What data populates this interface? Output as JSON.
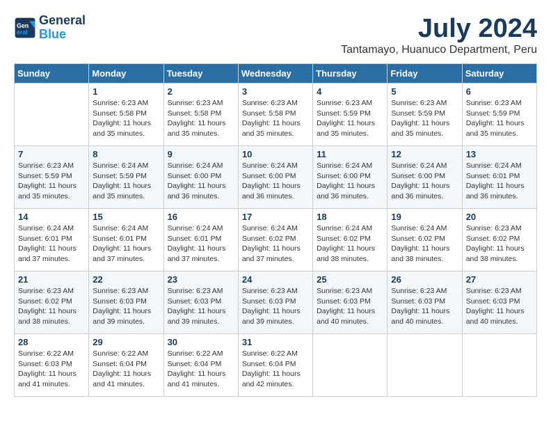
{
  "logo": {
    "line1": "General",
    "line2": "Blue"
  },
  "title": "July 2024",
  "location": "Tantamayo, Huanuco Department, Peru",
  "days_of_week": [
    "Sunday",
    "Monday",
    "Tuesday",
    "Wednesday",
    "Thursday",
    "Friday",
    "Saturday"
  ],
  "weeks": [
    [
      {
        "day": "",
        "info": ""
      },
      {
        "day": "1",
        "info": "Sunrise: 6:23 AM\nSunset: 5:58 PM\nDaylight: 11 hours\nand 35 minutes."
      },
      {
        "day": "2",
        "info": "Sunrise: 6:23 AM\nSunset: 5:58 PM\nDaylight: 11 hours\nand 35 minutes."
      },
      {
        "day": "3",
        "info": "Sunrise: 6:23 AM\nSunset: 5:58 PM\nDaylight: 11 hours\nand 35 minutes."
      },
      {
        "day": "4",
        "info": "Sunrise: 6:23 AM\nSunset: 5:59 PM\nDaylight: 11 hours\nand 35 minutes."
      },
      {
        "day": "5",
        "info": "Sunrise: 6:23 AM\nSunset: 5:59 PM\nDaylight: 11 hours\nand 35 minutes."
      },
      {
        "day": "6",
        "info": "Sunrise: 6:23 AM\nSunset: 5:59 PM\nDaylight: 11 hours\nand 35 minutes."
      }
    ],
    [
      {
        "day": "7",
        "info": "Sunrise: 6:23 AM\nSunset: 5:59 PM\nDaylight: 11 hours\nand 35 minutes."
      },
      {
        "day": "8",
        "info": "Sunrise: 6:24 AM\nSunset: 5:59 PM\nDaylight: 11 hours\nand 35 minutes."
      },
      {
        "day": "9",
        "info": "Sunrise: 6:24 AM\nSunset: 6:00 PM\nDaylight: 11 hours\nand 36 minutes."
      },
      {
        "day": "10",
        "info": "Sunrise: 6:24 AM\nSunset: 6:00 PM\nDaylight: 11 hours\nand 36 minutes."
      },
      {
        "day": "11",
        "info": "Sunrise: 6:24 AM\nSunset: 6:00 PM\nDaylight: 11 hours\nand 36 minutes."
      },
      {
        "day": "12",
        "info": "Sunrise: 6:24 AM\nSunset: 6:00 PM\nDaylight: 11 hours\nand 36 minutes."
      },
      {
        "day": "13",
        "info": "Sunrise: 6:24 AM\nSunset: 6:01 PM\nDaylight: 11 hours\nand 36 minutes."
      }
    ],
    [
      {
        "day": "14",
        "info": "Sunrise: 6:24 AM\nSunset: 6:01 PM\nDaylight: 11 hours\nand 37 minutes."
      },
      {
        "day": "15",
        "info": "Sunrise: 6:24 AM\nSunset: 6:01 PM\nDaylight: 11 hours\nand 37 minutes."
      },
      {
        "day": "16",
        "info": "Sunrise: 6:24 AM\nSunset: 6:01 PM\nDaylight: 11 hours\nand 37 minutes."
      },
      {
        "day": "17",
        "info": "Sunrise: 6:24 AM\nSunset: 6:02 PM\nDaylight: 11 hours\nand 37 minutes."
      },
      {
        "day": "18",
        "info": "Sunrise: 6:24 AM\nSunset: 6:02 PM\nDaylight: 11 hours\nand 38 minutes."
      },
      {
        "day": "19",
        "info": "Sunrise: 6:24 AM\nSunset: 6:02 PM\nDaylight: 11 hours\nand 38 minutes."
      },
      {
        "day": "20",
        "info": "Sunrise: 6:23 AM\nSunset: 6:02 PM\nDaylight: 11 hours\nand 38 minutes."
      }
    ],
    [
      {
        "day": "21",
        "info": "Sunrise: 6:23 AM\nSunset: 6:02 PM\nDaylight: 11 hours\nand 38 minutes."
      },
      {
        "day": "22",
        "info": "Sunrise: 6:23 AM\nSunset: 6:03 PM\nDaylight: 11 hours\nand 39 minutes."
      },
      {
        "day": "23",
        "info": "Sunrise: 6:23 AM\nSunset: 6:03 PM\nDaylight: 11 hours\nand 39 minutes."
      },
      {
        "day": "24",
        "info": "Sunrise: 6:23 AM\nSunset: 6:03 PM\nDaylight: 11 hours\nand 39 minutes."
      },
      {
        "day": "25",
        "info": "Sunrise: 6:23 AM\nSunset: 6:03 PM\nDaylight: 11 hours\nand 40 minutes."
      },
      {
        "day": "26",
        "info": "Sunrise: 6:23 AM\nSunset: 6:03 PM\nDaylight: 11 hours\nand 40 minutes."
      },
      {
        "day": "27",
        "info": "Sunrise: 6:23 AM\nSunset: 6:03 PM\nDaylight: 11 hours\nand 40 minutes."
      }
    ],
    [
      {
        "day": "28",
        "info": "Sunrise: 6:22 AM\nSunset: 6:03 PM\nDaylight: 11 hours\nand 41 minutes."
      },
      {
        "day": "29",
        "info": "Sunrise: 6:22 AM\nSunset: 6:04 PM\nDaylight: 11 hours\nand 41 minutes."
      },
      {
        "day": "30",
        "info": "Sunrise: 6:22 AM\nSunset: 6:04 PM\nDaylight: 11 hours\nand 41 minutes."
      },
      {
        "day": "31",
        "info": "Sunrise: 6:22 AM\nSunset: 6:04 PM\nDaylight: 11 hours\nand 42 minutes."
      },
      {
        "day": "",
        "info": ""
      },
      {
        "day": "",
        "info": ""
      },
      {
        "day": "",
        "info": ""
      }
    ]
  ]
}
